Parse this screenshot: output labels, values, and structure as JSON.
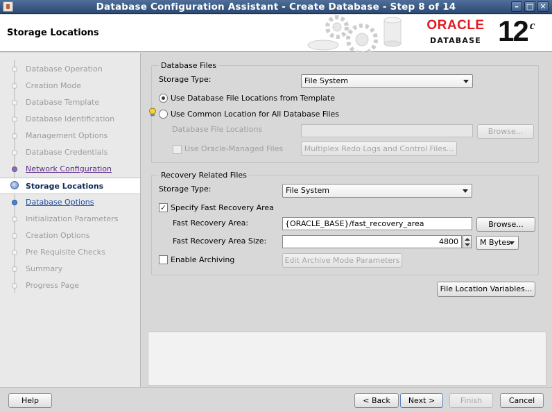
{
  "window": {
    "title": "Database Configuration Assistant - Create Database - Step 8 of 14",
    "controls": [
      "–",
      "□",
      "✕"
    ]
  },
  "header": {
    "page_title": "Storage Locations",
    "brand_word": "ORACLE",
    "brand_sub": "DATABASE",
    "version": "12",
    "version_suffix": "c"
  },
  "sidebar": {
    "items": [
      {
        "label": "Database Operation",
        "state": "disabled"
      },
      {
        "label": "Creation Mode",
        "state": "disabled"
      },
      {
        "label": "Database Template",
        "state": "disabled"
      },
      {
        "label": "Database Identification",
        "state": "disabled"
      },
      {
        "label": "Management Options",
        "state": "disabled"
      },
      {
        "label": "Database Credentials",
        "state": "disabled"
      },
      {
        "label": "Network Configuration",
        "state": "visited"
      },
      {
        "label": "Storage Locations",
        "state": "current"
      },
      {
        "label": "Database Options",
        "state": "link"
      },
      {
        "label": "Initialization Parameters",
        "state": "disabled"
      },
      {
        "label": "Creation Options",
        "state": "disabled"
      },
      {
        "label": "Pre Requisite Checks",
        "state": "disabled"
      },
      {
        "label": "Summary",
        "state": "disabled"
      },
      {
        "label": "Progress Page",
        "state": "disabled"
      }
    ]
  },
  "db_files": {
    "legend": "Database Files",
    "storage_type_label": "Storage Type:",
    "storage_type_value": "File System",
    "option_template": "Use Database File Locations from Template",
    "option_common": "Use Common Location for All Database Files",
    "file_locations_label": "Database File Locations",
    "file_locations_value": "",
    "browse_label": "Browse...",
    "omf_label": "Use Oracle-Managed Files",
    "multiplex_label": "Multiplex Redo Logs and Control Files..."
  },
  "recovery": {
    "legend": "Recovery Related Files",
    "storage_type_label": "Storage Type:",
    "storage_type_value": "File System",
    "specify_fra_label": "Specify Fast Recovery Area",
    "fra_label": "Fast Recovery Area:",
    "fra_value": "{ORACLE_BASE}/fast_recovery_area",
    "browse_label": "Browse...",
    "fra_size_label": "Fast Recovery Area Size:",
    "fra_size_value": "4800",
    "fra_unit": "M Bytes",
    "archiving_label": "Enable Archiving",
    "archive_params_label": "Edit Archive Mode Parameters"
  },
  "file_location_variables_label": "File Location Variables...",
  "footer": {
    "help": "Help",
    "back": "< Back",
    "next": "Next >",
    "finish": "Finish",
    "cancel": "Cancel"
  },
  "colors": {
    "titlebar": "#3a5a86",
    "oracle_red": "#e11b22",
    "current_step": "#0f2a5a"
  }
}
